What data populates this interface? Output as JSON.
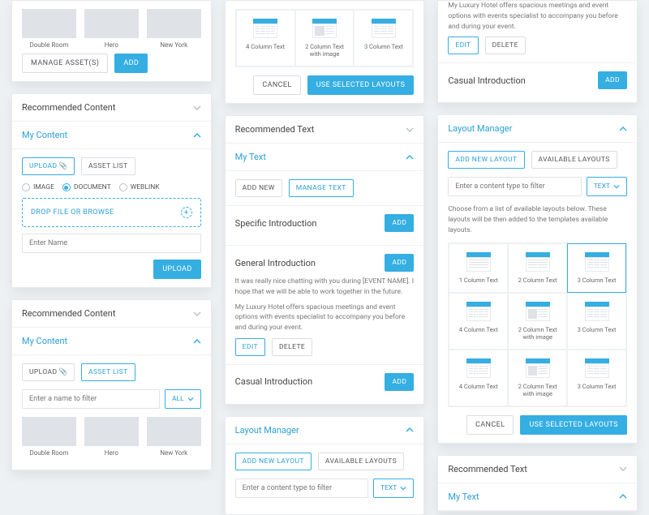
{
  "labels": {
    "manage_assets": "MANAGE ASSET(S)",
    "add": "ADD",
    "cancel": "CANCEL",
    "use_selected": "USE SELECTED LAYOUTS",
    "edit": "EDIT",
    "delete": "DELETE",
    "upload": "UPLOAD",
    "asset_list": "ASSET LIST",
    "add_new": "ADD NEW",
    "manage_text": "MANAGE TEXT",
    "add_new_layout": "ADD NEW LAYOUT",
    "available_layouts": "AVAILABLE LAYOUTS",
    "image": "IMAGE",
    "document": "DOCUMENT",
    "weblink": "WEBLINK",
    "drop": "DROP FILE OR BROWSE",
    "all": "ALL",
    "text": "TEXT"
  },
  "placeholders": {
    "enter_name": "Enter Name",
    "name_filter": "Enter a name to filter",
    "content_filter": "Enter a content type to filter"
  },
  "headers": {
    "rec_content": "Recommended Content",
    "my_content": "My Content",
    "rec_text": "Recommended Text",
    "my_text": "My Text",
    "layout_manager": "Layout Manager"
  },
  "assets": [
    "Double Room",
    "Hero",
    "New York"
  ],
  "intros": {
    "specific": "Specific Introduction",
    "general": "General Introduction",
    "casual": "Casual Introduction",
    "body1": "It was really nice chatting with you during [EVENT NAME]. I hope that we will be able to work together in the future.",
    "body2": "My Luxury Hotel offers spacious meetings and event options with events specialist to accompany you before and during your event."
  },
  "lm": {
    "hint": "Choose from a list of available layouts below. These layouts will be then added to the templates available layouts.",
    "layouts": [
      {
        "n": "1 Column Text",
        "cols": 1
      },
      {
        "n": "2 Column Text",
        "cols": 2
      },
      {
        "n": "3 Column Text",
        "cols": 3
      },
      {
        "n": "4 Column Text",
        "cols": 4
      },
      {
        "n": "2 Column Text with image",
        "cols": 2,
        "img": true
      },
      {
        "n": "3 Column Text",
        "cols": 3
      },
      {
        "n": "4 Column Text",
        "cols": 4
      },
      {
        "n": "2 Column Text with image",
        "cols": 2,
        "img": true
      },
      {
        "n": "3 Column Text",
        "cols": 3
      }
    ],
    "top3": [
      {
        "n": "4 Column Text",
        "cols": 4
      },
      {
        "n": "2 Column Text with image",
        "cols": 2,
        "img": true
      },
      {
        "n": "3 Column Text",
        "cols": 3
      }
    ]
  }
}
